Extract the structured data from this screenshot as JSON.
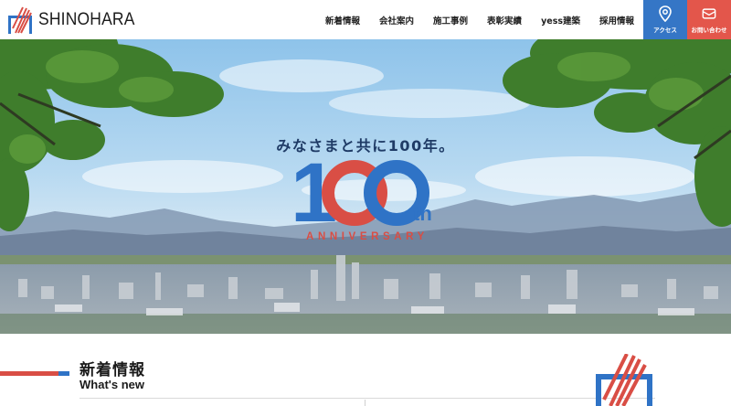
{
  "header": {
    "logo_text": "SHINOHARA",
    "nav": [
      "新着情報",
      "会社案内",
      "施工事例",
      "表彰実績",
      "yess建築",
      "採用情報"
    ],
    "access_label": "アクセス",
    "contact_label": "お問い合わせ"
  },
  "hero": {
    "tagline": "みなさまと共に100年。",
    "badge_digit": "1",
    "badge_suffix": "th",
    "badge_word": "ANNIVERSARY"
  },
  "news": {
    "title": "新着情報",
    "subtitle": "What's new"
  },
  "colors": {
    "brand_blue": "#2f73c6",
    "brand_red": "#d94e45",
    "access_bg": "#3576c6",
    "contact_bg": "#e3564b"
  },
  "icons": [
    "logo-mark-icon",
    "map-pin-icon",
    "mail-icon"
  ]
}
